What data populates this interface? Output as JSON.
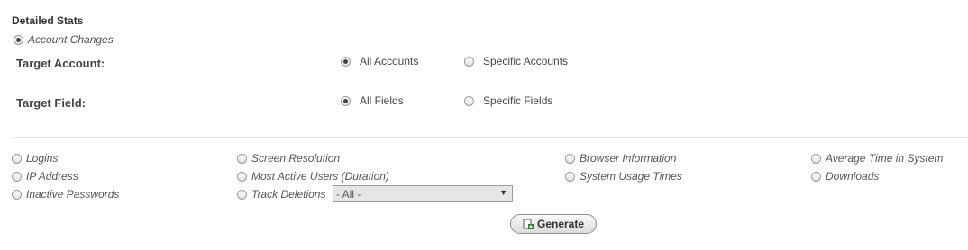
{
  "section": {
    "title": "Detailed Stats",
    "account_changes_label": "Account Changes"
  },
  "target_account": {
    "label": "Target Account:",
    "options": [
      {
        "label": "All Accounts",
        "selected": true
      },
      {
        "label": "Specific Accounts",
        "selected": false
      }
    ]
  },
  "target_field": {
    "label": "Target Field:",
    "options": [
      {
        "label": "All Fields",
        "selected": true
      },
      {
        "label": "Specific Fields",
        "selected": false
      }
    ]
  },
  "report_options": {
    "col1": [
      "Logins",
      "IP Address",
      "Inactive Passwords"
    ],
    "col2": [
      "Screen Resolution",
      "Most Active Users (Duration)",
      "Track Deletions"
    ],
    "col3": [
      "Browser Information",
      "System Usage Times"
    ],
    "col4": [
      "Average Time in System",
      "Downloads"
    ]
  },
  "track_deletions_select": {
    "value": "- All -"
  },
  "generate_button": {
    "label": "Generate",
    "icon": "add-document-icon"
  }
}
